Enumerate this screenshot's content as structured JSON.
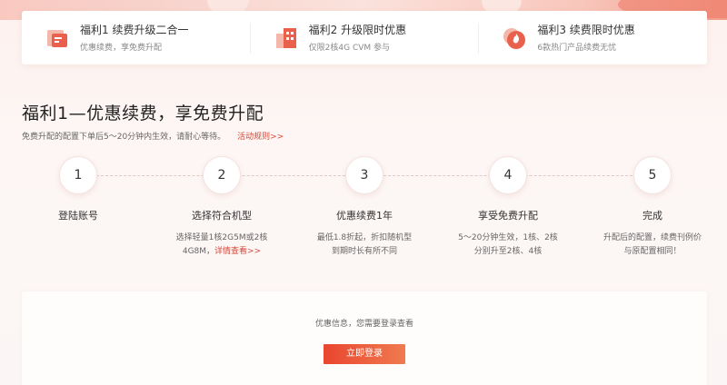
{
  "benefits": [
    {
      "title": "福利1 续费升级二合一",
      "desc": "优惠续费，享免费升配",
      "icon": "server-renew-icon"
    },
    {
      "title": "福利2 升级限时优惠",
      "desc": "仅限2核4G CVM 参与",
      "icon": "building-upgrade-icon"
    },
    {
      "title": "福利3 续费限时优惠",
      "desc": "6款热门产品续费无忧",
      "icon": "flame-badge-icon"
    }
  ],
  "section": {
    "title": "福利1—优惠续费，享免费升配",
    "subtitle": "免费升配的配置下单后5～20分钟内生效，请耐心等待。",
    "rule_link": "活动规则>>"
  },
  "steps": [
    {
      "num": "1",
      "title": "登陆账号",
      "desc": ""
    },
    {
      "num": "2",
      "title": "选择符合机型",
      "desc": "选择轻量1核2G5M或2核4G8M，",
      "link": "详情查看>>"
    },
    {
      "num": "3",
      "title": "优惠续费1年",
      "desc": "最低1.8折起，折扣随机型到期时长有所不同"
    },
    {
      "num": "4",
      "title": "享受免费升配",
      "desc": "5～20分钟生效，1核、2核分别升至2核、4核"
    },
    {
      "num": "5",
      "title": "完成",
      "desc": "升配后的配置，续费刊例价与原配置相同！"
    }
  ],
  "login": {
    "info": "优惠信息，您需要登录查看",
    "button": "立即登录"
  },
  "colors": {
    "accent": "#e9462f",
    "link": "#d24a3a"
  }
}
